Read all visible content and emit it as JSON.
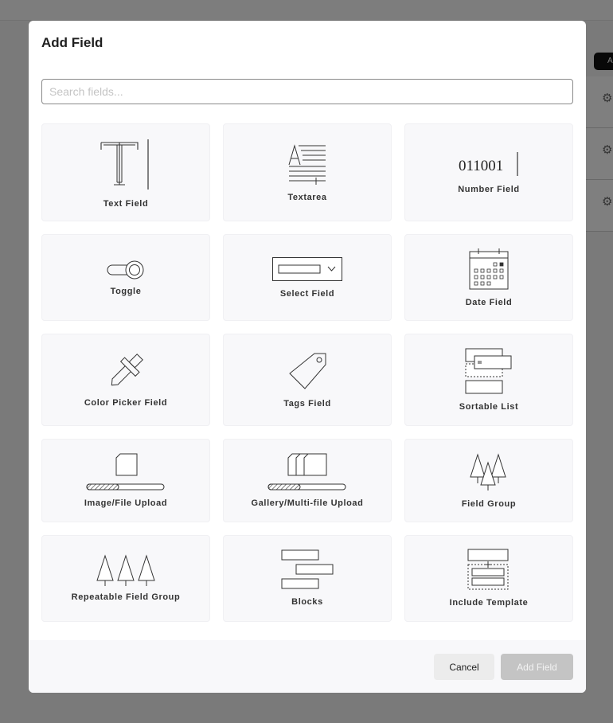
{
  "modal": {
    "title": "Add Field",
    "search_placeholder": "Search fields...",
    "cancel_label": "Cancel",
    "add_label": "Add Field"
  },
  "background": {
    "badge": "A"
  },
  "fields": [
    {
      "label": "Text Field",
      "icon": "text-field-icon"
    },
    {
      "label": "Textarea",
      "icon": "textarea-icon"
    },
    {
      "label": "Number Field",
      "icon": "number-field-icon",
      "icon_text": "011001"
    },
    {
      "label": "Toggle",
      "icon": "toggle-icon"
    },
    {
      "label": "Select Field",
      "icon": "select-field-icon"
    },
    {
      "label": "Date Field",
      "icon": "calendar-icon"
    },
    {
      "label": "Color Picker Field",
      "icon": "eyedropper-icon"
    },
    {
      "label": "Tags Field",
      "icon": "tag-icon"
    },
    {
      "label": "Sortable List",
      "icon": "sortable-list-icon"
    },
    {
      "label": "Image/File Upload",
      "icon": "file-upload-icon"
    },
    {
      "label": "Gallery/Multi-file Upload",
      "icon": "multi-file-upload-icon"
    },
    {
      "label": "Field Group",
      "icon": "field-group-icon"
    },
    {
      "label": "Repeatable Field Group",
      "icon": "repeatable-group-icon"
    },
    {
      "label": "Blocks",
      "icon": "blocks-icon"
    },
    {
      "label": "Include Template",
      "icon": "include-template-icon"
    }
  ]
}
